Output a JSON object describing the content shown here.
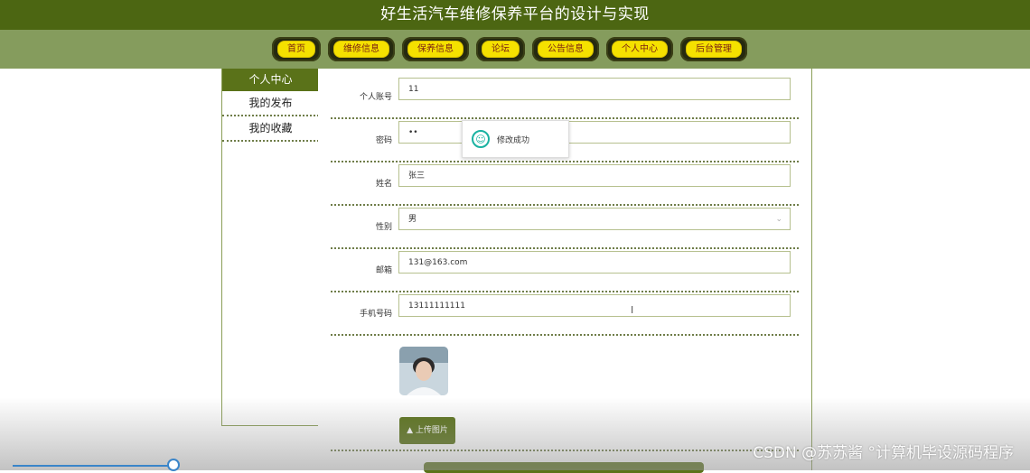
{
  "header": {
    "title": "好生活汽车维修保养平台的设计与实现"
  },
  "nav": {
    "items": [
      {
        "label": "首页"
      },
      {
        "label": "维修信息"
      },
      {
        "label": "保养信息"
      },
      {
        "label": "论坛"
      },
      {
        "label": "公告信息"
      },
      {
        "label": "个人中心"
      },
      {
        "label": "后台管理"
      }
    ]
  },
  "sidebar": {
    "title": "个人中心",
    "items": [
      {
        "label": "我的发布"
      },
      {
        "label": "我的收藏"
      }
    ]
  },
  "form": {
    "account": {
      "label": "个人账号",
      "value": "11"
    },
    "password": {
      "label": "密码",
      "value": "••"
    },
    "name": {
      "label": "姓名",
      "value": "张三"
    },
    "gender": {
      "label": "性别",
      "value": "男"
    },
    "email": {
      "label": "邮箱",
      "value": "131@163.com"
    },
    "phone": {
      "label": "手机号码",
      "value": "13111111111"
    },
    "upload_label": "上传图片"
  },
  "toast": {
    "message": "修改成功",
    "icon": "smile-icon"
  },
  "watermark": "CSDN @苏苏酱  °计算机毕设源码程序",
  "colors": {
    "header_bg": "#4c6612",
    "nav_bg": "#859c5d",
    "pill_bg": "#f5e100",
    "accent": "#5a7219"
  }
}
